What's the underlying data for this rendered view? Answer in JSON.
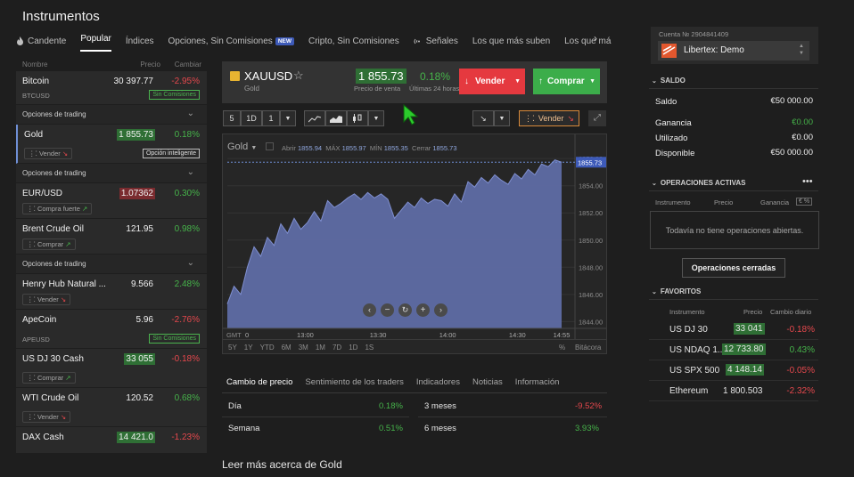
{
  "header": {
    "title": "Instrumentos"
  },
  "tabs": [
    {
      "label": "Candente",
      "icon": "fire-icon"
    },
    {
      "label": "Popular"
    },
    {
      "label": "Índices"
    },
    {
      "label": "Opciones, Sin Comisiones",
      "badge": "NEW"
    },
    {
      "label": "Cripto, Sin Comisiones"
    },
    {
      "label": "Señales",
      "icon": "signal-icon"
    },
    {
      "label": "Los que más suben"
    },
    {
      "label": "Los que má"
    }
  ],
  "list": {
    "col_name": "Nombre",
    "col_price": "Precio",
    "col_change": "Cambiar",
    "options_label": "Opciones de trading",
    "rows": [
      {
        "name": "Bitcoin",
        "price": "30 397.77",
        "change": "-2.95%",
        "sub": "BTCUSD",
        "badge": "Sin Comisiones"
      },
      {
        "name": "Gold",
        "price": "1 855.73",
        "change": "0.18%",
        "signal": "Vender",
        "badge": "Opción inteligente"
      },
      {
        "name": "EUR/USD",
        "price": "1.07362",
        "change": "0.30%",
        "signal": "Compra fuerte"
      },
      {
        "name": "Brent Crude Oil",
        "price": "121.95",
        "change": "0.98%",
        "signal": "Comprar"
      },
      {
        "name": "Henry Hub Natural ...",
        "price": "9.566",
        "change": "2.48%",
        "signal": "Vender"
      },
      {
        "name": "ApeCoin",
        "price": "5.96",
        "change": "-2.76%",
        "sub": "APEUSD",
        "badge": "Sin Comisiones"
      },
      {
        "name": "US DJ 30 Cash",
        "price": "33 055",
        "change": "-0.18%",
        "signal": "Comprar"
      },
      {
        "name": "WTI Crude Oil",
        "price": "120.52",
        "change": "0.68%",
        "signal": "Vender"
      },
      {
        "name": "DAX Cash",
        "price": "14 421.0",
        "change": "-1.23%"
      }
    ]
  },
  "instrument": {
    "symbol": "XAUUSD",
    "name": "Gold",
    "sell_price": "1 855.73",
    "sell_label": "Precio de venta",
    "change": "0.18%",
    "change_label": "Últimas 24 horas",
    "sell_button": "Vender",
    "buy_button": "Comprar"
  },
  "toolbar": {
    "interval_a": "5",
    "interval_b": "1D",
    "interval_c": "1",
    "signal_label": "Vender"
  },
  "chart_data": {
    "type": "area",
    "title": "Gold",
    "ohlc": {
      "open_label": "Abrir",
      "open": "1855.94",
      "high_label": "MÁX",
      "high": "1855.97",
      "low_label": "MÍN",
      "low": "1855.35",
      "close_label": "Cerrar",
      "close": "1855.73"
    },
    "current_label": "1855.73",
    "x_ticks": [
      "0",
      "13:00",
      "13:30",
      "14:00",
      "14:30",
      "14:55"
    ],
    "x_prefix": "GMT",
    "y_ticks": [
      "1856.00",
      "1854.00",
      "1852.00",
      "1850.00",
      "1848.00",
      "1846.00",
      "1844.00"
    ],
    "ylim": [
      1843.5,
      1856.6
    ],
    "x": [
      0,
      2,
      4,
      6,
      8,
      10,
      12,
      14,
      16,
      18,
      20,
      22,
      24,
      26,
      28,
      30,
      32,
      34,
      36,
      38,
      40,
      42,
      44,
      46,
      48,
      50,
      52,
      54,
      56,
      58,
      60,
      62,
      64,
      66,
      68,
      70,
      72,
      74,
      76,
      78,
      80,
      82,
      84,
      86,
      88,
      90,
      92,
      94,
      96,
      98,
      100
    ],
    "values": [
      1845.3,
      1846.6,
      1846.0,
      1848.0,
      1849.5,
      1848.8,
      1850.2,
      1849.6,
      1851.2,
      1850.5,
      1851.6,
      1850.8,
      1851.3,
      1852.1,
      1851.4,
      1852.9,
      1852.4,
      1852.7,
      1853.1,
      1853.4,
      1853.0,
      1853.5,
      1853.1,
      1853.4,
      1853.0,
      1851.6,
      1852.2,
      1852.8,
      1852.4,
      1853.1,
      1852.7,
      1853.0,
      1852.9,
      1852.5,
      1853.4,
      1852.8,
      1854.3,
      1853.9,
      1854.6,
      1854.2,
      1854.8,
      1854.4,
      1854.1,
      1854.9,
      1854.5,
      1855.2,
      1854.8,
      1855.6,
      1855.4,
      1855.9,
      1855.73
    ],
    "color": "#5f6ea8",
    "range_buttons": [
      "5Y",
      "1Y",
      "YTD",
      "6M",
      "3M",
      "1M",
      "7D",
      "1D",
      "1S"
    ],
    "percent_label": "%",
    "log_label": "Bitácora"
  },
  "subtabs": [
    "Cambio de precio",
    "Sentimiento de los traders",
    "Indicadores",
    "Noticias",
    "Información"
  ],
  "price_change": [
    {
      "label": "Día",
      "value": "0.18%"
    },
    {
      "label": "Semana",
      "value": "0.51%"
    },
    {
      "label": "3 meses",
      "value": "-9.52%"
    },
    {
      "label": "6 meses",
      "value": "3.93%"
    }
  ],
  "read_more": "Leer más acerca de Gold",
  "account": {
    "number": "Cuenta № 2904841409",
    "name": "Libertex: Demo"
  },
  "balance": {
    "section": "SALDO",
    "rows": [
      {
        "label": "Saldo",
        "value": "€50 000.00"
      },
      {
        "label": "Ganancia",
        "value": "€0.00"
      },
      {
        "label": "Utilizado",
        "value": "€0.00"
      },
      {
        "label": "Disponible",
        "value": "€50 000.00"
      }
    ]
  },
  "operations": {
    "section": "OPERACIONES ACTIVAS",
    "cols": [
      "Instrumento",
      "Precio",
      "Ganancia"
    ],
    "empty": "Todavía no tiene operaciones abiertas.",
    "closed_button": "Operaciones cerradas"
  },
  "favorites": {
    "section": "FAVORITOS",
    "cols": [
      "Instrumento",
      "Precio",
      "Cambio diario"
    ],
    "rows": [
      {
        "name": "US DJ 30",
        "price": "33 041",
        "change": "-0.18%"
      },
      {
        "name": "US NDAQ 1...",
        "price": "12 733.80",
        "change": "0.43%"
      },
      {
        "name": "US SPX 500",
        "price": "4 148.14",
        "change": "-0.05%"
      },
      {
        "name": "Ethereum",
        "price": "1 800.503",
        "change": "-2.32%"
      }
    ]
  }
}
